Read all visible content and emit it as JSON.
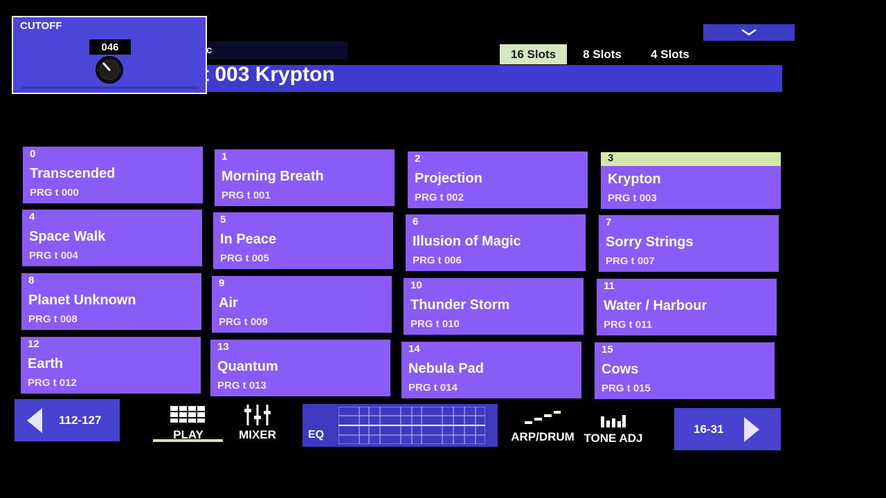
{
  "cutoff": {
    "label": "CUTOFF",
    "value": "046"
  },
  "header": {
    "label_fragment": "c",
    "program_title": "t 003 Krypton"
  },
  "slot_tabs": [
    {
      "label": "16 Slots",
      "active": true
    },
    {
      "label": "8 Slots",
      "active": false
    },
    {
      "label": "4 Slots",
      "active": false
    }
  ],
  "programs": [
    {
      "num": "0",
      "name": "Transcended",
      "prg": "PRG t 000"
    },
    {
      "num": "1",
      "name": "Morning Breath",
      "prg": "PRG t 001"
    },
    {
      "num": "2",
      "name": "Projection",
      "prg": "PRG t 002"
    },
    {
      "num": "3",
      "name": "Krypton",
      "prg": "PRG t 003"
    },
    {
      "num": "4",
      "name": "Space Walk",
      "prg": "PRG t 004"
    },
    {
      "num": "5",
      "name": "In Peace",
      "prg": "PRG t 005"
    },
    {
      "num": "6",
      "name": "Illusion of Magic",
      "prg": "PRG t 006"
    },
    {
      "num": "7",
      "name": "Sorry Strings",
      "prg": "PRG t 007"
    },
    {
      "num": "8",
      "name": "Planet Unknown",
      "prg": "PRG t 008"
    },
    {
      "num": "9",
      "name": "Air",
      "prg": "PRG t 009"
    },
    {
      "num": "10",
      "name": "Thunder Storm",
      "prg": "PRG t 010"
    },
    {
      "num": "11",
      "name": "Water / Harbour",
      "prg": "PRG t 011"
    },
    {
      "num": "12",
      "name": "Earth",
      "prg": "PRG t 012"
    },
    {
      "num": "13",
      "name": "Quantum",
      "prg": "PRG t 013"
    },
    {
      "num": "14",
      "name": "Nebula Pad",
      "prg": "PRG t 014"
    },
    {
      "num": "15",
      "name": "Cows",
      "prg": "PRG t 015"
    }
  ],
  "selected_index": 3,
  "bottom": {
    "prev_range": "112-127",
    "next_range": "16-31",
    "play_label": "PLAY",
    "mixer_label": "MIXER",
    "eq_label": "EQ",
    "arp_label": "ARP/DRUM",
    "tone_label": "TONE ADJ"
  },
  "colors": {
    "tile": "#8a5cf7",
    "selected_bar": "#d4e6a8",
    "panel_blue": "#4743d0",
    "background": "#000000"
  }
}
